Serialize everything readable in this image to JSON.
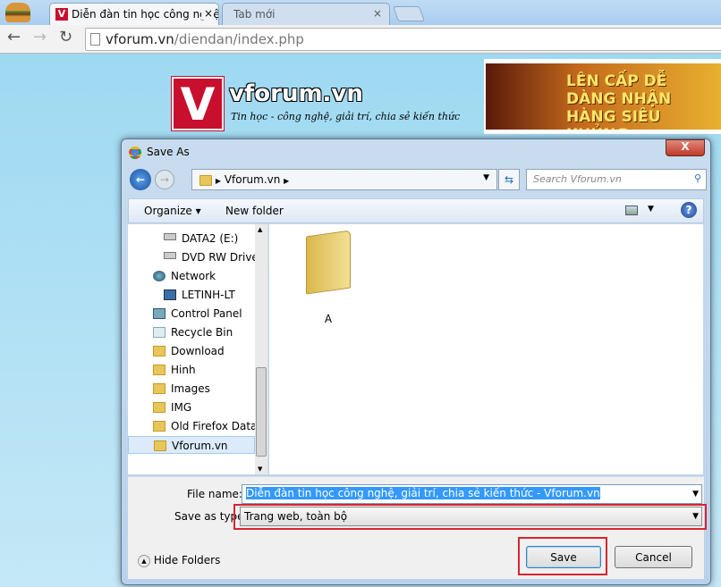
{
  "browser": {
    "tabs": [
      {
        "label": "Diễn đàn tin học công nghệ",
        "close": "×"
      },
      {
        "label": "Tab mới",
        "close": "×"
      }
    ],
    "url_host": "vforum.vn",
    "url_path": "/diendan/index.php"
  },
  "site": {
    "logo_text": "vforum.vn",
    "tagline": "Tin học - công nghệ, giải trí, chia sẻ kiến thức",
    "banner": "LÊN CẤP DỄ DÀNG NHẬN HÀNG SIÊU KHỦNG"
  },
  "dialog": {
    "title": "Save As",
    "close": "X",
    "breadcrumb": "Vforum.vn",
    "search_placeholder": "Search Vforum.vn",
    "organize": "Organize ▾",
    "new_folder": "New folder",
    "nav": [
      {
        "label": "DATA2 (E:)",
        "icon": "drive-icon"
      },
      {
        "label": "DVD RW Drive (",
        "icon": "dvd-drive-icon"
      },
      {
        "label": "Network",
        "icon": "network-icon"
      },
      {
        "label": "LETINH-LT",
        "icon": "computer-icon"
      },
      {
        "label": "Control Panel",
        "icon": "control-panel-icon"
      },
      {
        "label": "Recycle Bin",
        "icon": "recycle-bin-icon"
      },
      {
        "label": "Download",
        "icon": "folder-icon"
      },
      {
        "label": "Hinh",
        "icon": "folder-icon"
      },
      {
        "label": "Images",
        "icon": "folder-icon"
      },
      {
        "label": "IMG",
        "icon": "folder-icon"
      },
      {
        "label": "Old Firefox Data",
        "icon": "folder-icon"
      },
      {
        "label": "Vforum.vn",
        "icon": "folder-icon",
        "selected": true
      }
    ],
    "files": [
      {
        "label": "A",
        "icon": "folder-icon"
      }
    ],
    "file_name_label": "File name:",
    "file_name_value": "Diễn đàn tin học công nghệ, giải trí, chia sẻ kiến thức - Vforum.vn",
    "save_type_label": "Save as type:",
    "save_type_value": "Trang web, toàn bộ",
    "hide_folders": "Hide Folders",
    "save": "Save",
    "cancel": "Cancel",
    "highlight_color": "#d9252f"
  }
}
